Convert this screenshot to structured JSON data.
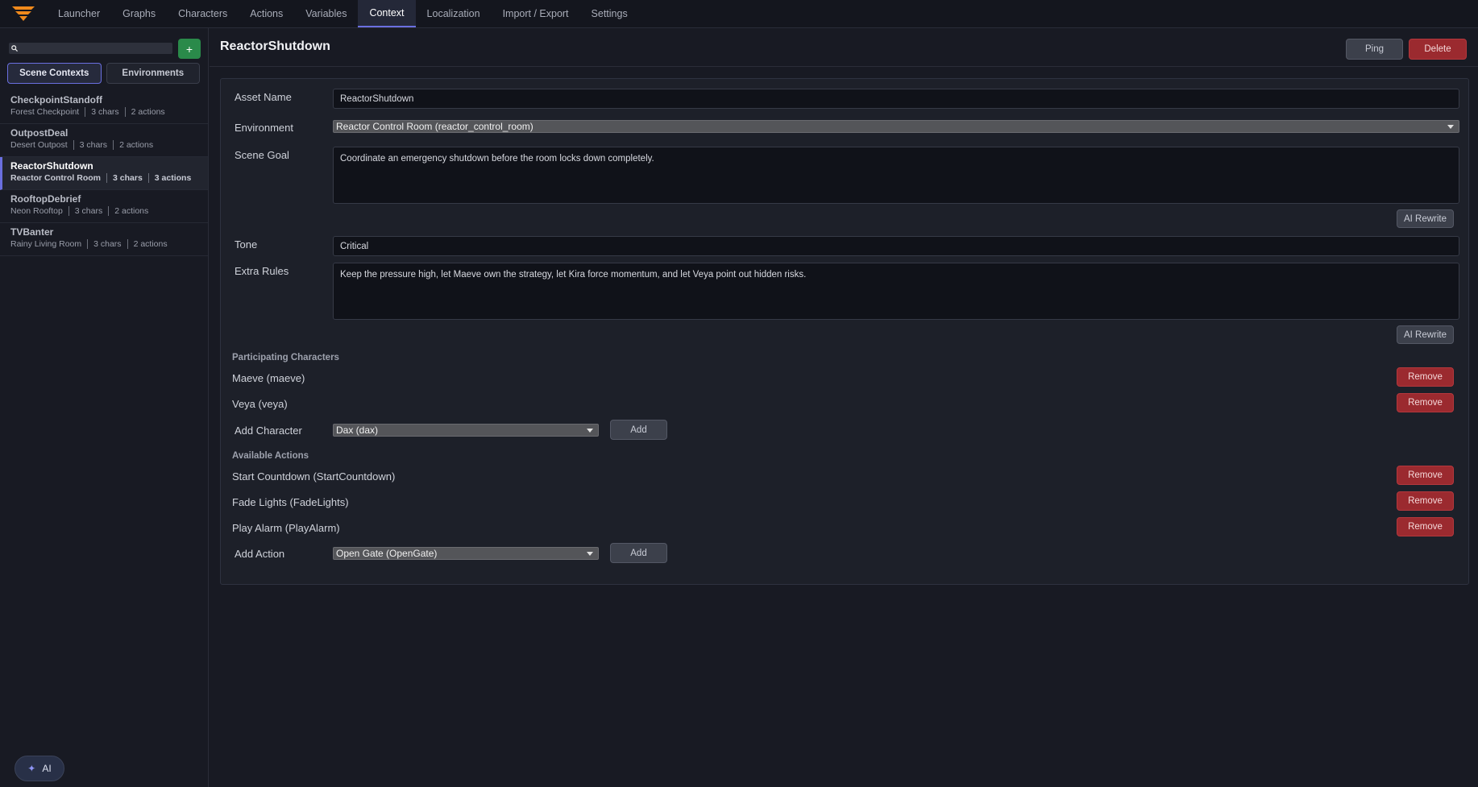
{
  "nav": {
    "tabs": [
      "Launcher",
      "Graphs",
      "Characters",
      "Actions",
      "Variables",
      "Context",
      "Localization",
      "Import / Export",
      "Settings"
    ],
    "active_tab": "Context"
  },
  "sidebar": {
    "search_placeholder": "",
    "add_label": "+",
    "tabs": [
      "Scene Contexts",
      "Environments"
    ],
    "items": [
      {
        "name": "CheckpointStandoff",
        "env": "Forest Checkpoint",
        "chars": "3 chars",
        "actions": "2 actions"
      },
      {
        "name": "OutpostDeal",
        "env": "Desert Outpost",
        "chars": "3 chars",
        "actions": "2 actions"
      },
      {
        "name": "ReactorShutdown",
        "env": "Reactor Control Room",
        "chars": "3 chars",
        "actions": "3 actions"
      },
      {
        "name": "RooftopDebrief",
        "env": "Neon Rooftop",
        "chars": "3 chars",
        "actions": "2 actions"
      },
      {
        "name": "TVBanter",
        "env": "Rainy Living Room",
        "chars": "3 chars",
        "actions": "2 actions"
      }
    ],
    "ai_label": "AI"
  },
  "main": {
    "title": "ReactorShutdown",
    "ping_label": "Ping",
    "delete_label": "Delete",
    "form": {
      "asset_name_label": "Asset Name",
      "asset_name_value": "ReactorShutdown",
      "environment_label": "Environment",
      "environment_value": "Reactor Control Room (reactor_control_room)",
      "scene_goal_label": "Scene Goal",
      "scene_goal_value": "Coordinate an emergency shutdown before the room locks down completely.",
      "ai_rewrite_label": "AI Rewrite",
      "tone_label": "Tone",
      "tone_value": "Critical",
      "extra_rules_label": "Extra Rules",
      "extra_rules_value": "Keep the pressure high, let Maeve own the strategy, let Kira force momentum, and let Veya point out hidden risks."
    },
    "characters": {
      "title": "Participating Characters",
      "items": [
        "Maeve (maeve)",
        "Veya (veya)"
      ],
      "remove_label": "Remove",
      "add_label": "Add Character",
      "add_select_value": "Dax (dax)",
      "add_button": "Add"
    },
    "actions": {
      "title": "Available Actions",
      "items": [
        "Start Countdown (StartCountdown)",
        "Fade Lights (FadeLights)",
        "Play Alarm (PlayAlarm)"
      ],
      "remove_label": "Remove",
      "add_label": "Add Action",
      "add_select_value": "Open Gate (OpenGate)",
      "add_button": "Add"
    }
  },
  "colors": {
    "accent": "#6a6fe0",
    "danger": "#9b2a2f",
    "success": "#2a8a4a",
    "background": "#181a23"
  }
}
